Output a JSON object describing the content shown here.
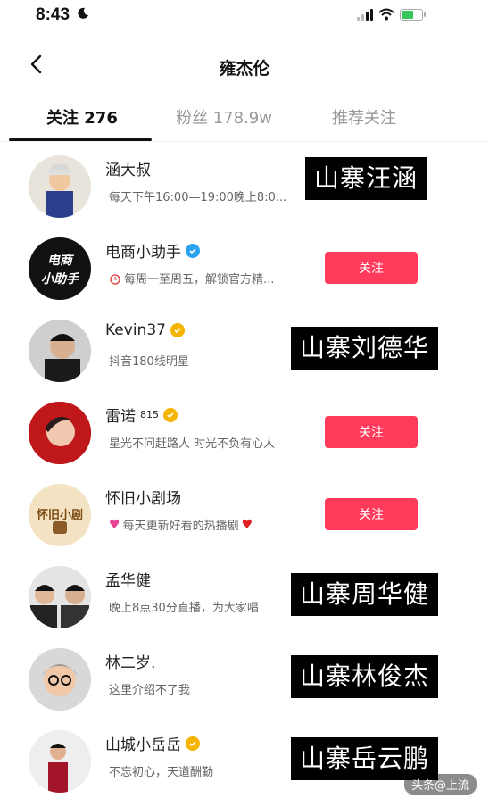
{
  "status_bar": {
    "time": "8:43"
  },
  "header": {
    "title": "雍杰伦"
  },
  "tabs": [
    {
      "label": "关注 276",
      "active": true
    },
    {
      "label": "粉丝 178.9w",
      "active": false
    },
    {
      "label": "推荐关注",
      "active": false
    }
  ],
  "accent_color": "#ff3b5c",
  "users": [
    {
      "name": "涵大叔",
      "description": "每天下午16:00—19:00晚上8:0...",
      "verified": "none",
      "follow_label": "",
      "caption": "山寨汪涵"
    },
    {
      "name": "电商小助手",
      "description": "每周一至周五，解锁官方精...",
      "verified": "blue",
      "follow_label": "关注",
      "caption": "",
      "desc_icon": "alarm-clock-icon",
      "avatar_text_1": "电商",
      "avatar_text_2": "小助手"
    },
    {
      "name": "Kevin37",
      "description": "抖音180线明星",
      "verified": "gold",
      "follow_label": "",
      "caption": "山寨刘德华"
    },
    {
      "name": "雷诺",
      "name_sup": "815",
      "description": "星光不问赶路人 时光不负有心人",
      "verified": "gold",
      "follow_label": "关注",
      "caption": ""
    },
    {
      "name": "怀旧小剧场",
      "description": "每天更新好看的热播剧",
      "verified": "none",
      "follow_label": "关注",
      "caption": "",
      "desc_icon": "heart-icon",
      "avatar_text_1": "怀旧小剧"
    },
    {
      "name": "孟华健",
      "description": "晚上8点30分直播，为大家唱",
      "verified": "none",
      "follow_label": "",
      "caption": "山寨周华健"
    },
    {
      "name": "林二岁.",
      "description": "这里介绍不了我",
      "verified": "none",
      "follow_label": "",
      "caption": "山寨林俊杰"
    },
    {
      "name": "山城小岳岳",
      "description": "不忘初心，天道酬勤",
      "verified": "gold",
      "follow_label": "",
      "caption": "山寨岳云鹏"
    }
  ],
  "watermark": "头条@上流"
}
